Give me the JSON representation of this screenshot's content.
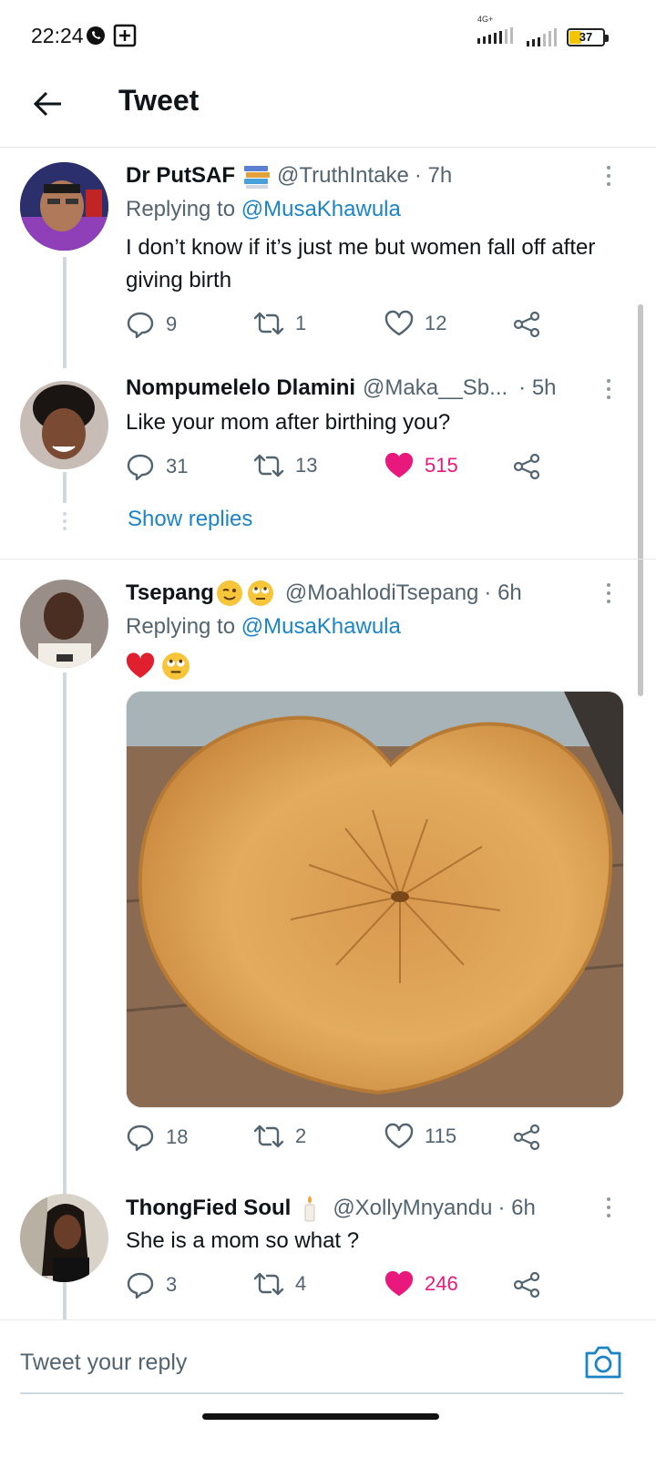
{
  "status_bar": {
    "time": "22:24",
    "network_label": "4G+",
    "battery": "37",
    "battery_level_pct": 37
  },
  "header": {
    "title": "Tweet",
    "back_icon": "arrow-left-icon"
  },
  "tweets": [
    {
      "name": "Dr PutSAF",
      "handle": "@TruthIntake",
      "time": "· 7h",
      "replying_prefix": "Replying to",
      "replying_to": "@MusaKhawula",
      "text": "I don’t know if it’s just me but women fall off after giving birth",
      "replies": "9",
      "retweets": "1",
      "likes": "12",
      "liked": false
    },
    {
      "name": "Nompumelelo Dlamini",
      "handle": "@Maka__Sb...",
      "time": "· 5h",
      "text": "Like your mom after birthing you?",
      "replies": "31",
      "retweets": "13",
      "likes": "515",
      "liked": true
    },
    {
      "name": "Tsepang",
      "handle": "@MoahlodiTsepang",
      "time": "· 6h",
      "replying_prefix": "Replying to",
      "replying_to": "@MusaKhawula",
      "replies": "18",
      "retweets": "2",
      "likes": "115",
      "liked": false
    },
    {
      "name": "ThongFied Soul",
      "handle": "@XollyMnyandu",
      "time": "· 6h",
      "text": "She is a mom so what ?",
      "replies": "3",
      "retweets": "4",
      "likes": "246",
      "liked": true
    }
  ],
  "show_replies": "Show replies",
  "reply_bar": {
    "placeholder": "Tweet your reply"
  },
  "colors": {
    "link": "#1b84c7",
    "like": "#e8187c",
    "muted": "#536471",
    "thread_line": "#cfd9de"
  }
}
